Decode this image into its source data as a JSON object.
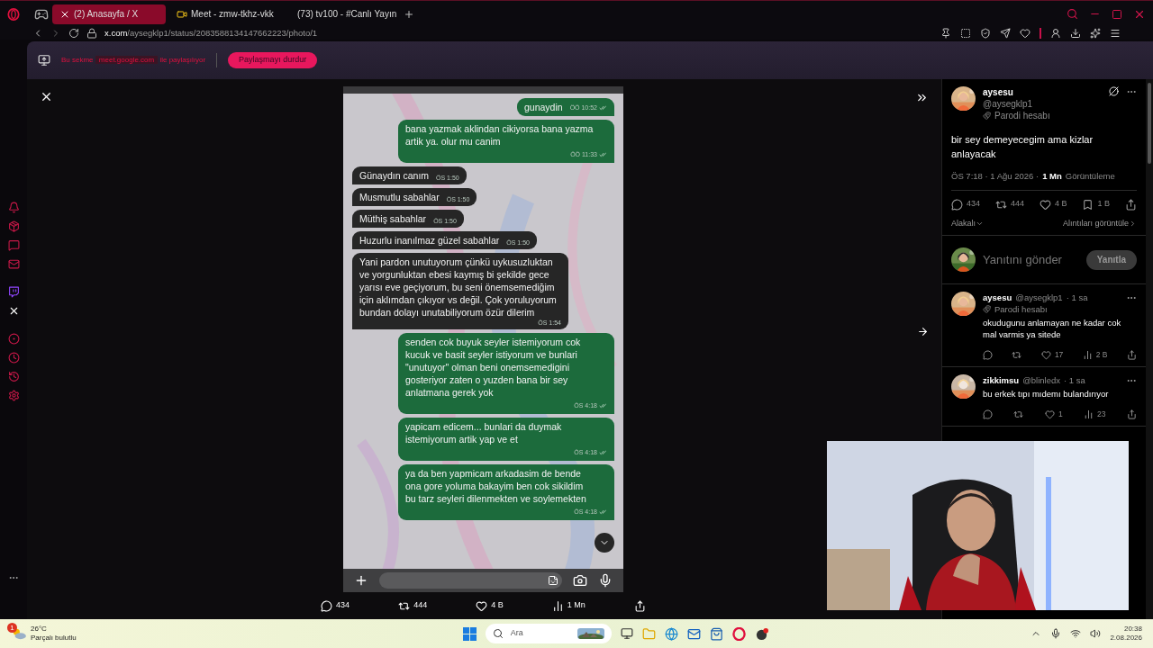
{
  "browser": {
    "tabs": [
      {
        "kind": "x",
        "title": "(2) Anasayfa / X",
        "selected": true
      },
      {
        "kind": "meet",
        "title": "Meet - zmw-tkhz-vkk",
        "selected": false
      },
      {
        "kind": "youtube",
        "title": "(73) tv100 - #Canlı Yayın",
        "selected": false
      }
    ],
    "url_host": "x.com",
    "url_path": "/aysegklp1/status/2083588134147662223/photo/1"
  },
  "share_banner": {
    "text_before": "Bu sekme",
    "site": "meet.google.com",
    "text_after": "ile paylaşılıyor",
    "button": "Paylaşmayı durdur"
  },
  "chat": {
    "messages": [
      {
        "kind": "sent",
        "text": "gunaydin",
        "time": "ÖÖ 10:52",
        "read": true
      },
      {
        "kind": "sent",
        "text": "bana yazmak aklindan cikiyorsa bana yazma artik ya. olur mu canim",
        "time": "ÖÖ 11:33",
        "read": true
      },
      {
        "kind": "received",
        "text": "Günaydın canım",
        "time": "ÖS 1:50",
        "read": false
      },
      {
        "kind": "received",
        "text": "Musmutlu sabahlar",
        "time": "ÖS 1:50",
        "read": false
      },
      {
        "kind": "received",
        "text": "Müthiş sabahlar",
        "time": "ÖS 1:50",
        "read": false
      },
      {
        "kind": "received",
        "text": "Huzurlu inanılmaz güzel sabahlar",
        "time": "ÖS 1:50",
        "read": false
      },
      {
        "kind": "received",
        "text": "Yani pardon unutuyorum çünkü uykusuzluktan ve yorgunluktan ebesi kaymış bi şekilde gece yarısı eve geçiyorum, bu seni önemsemediğim için aklımdan çıkıyor vs değil. Çok yoruluyorum bundan dolayı unutabiliyorum özür dilerim",
        "time": "ÖS 1:54",
        "read": false
      },
      {
        "kind": "sent",
        "text": "senden cok buyuk seyler istemiyorum cok kucuk ve basit seyler istiyorum ve bunlari \"unutuyor\" olman beni onemsemedigini gosteriyor zaten o yuzden bana bir sey anlatmana gerek yok",
        "time": "ÖS 4:18",
        "read": true
      },
      {
        "kind": "sent",
        "text": "yapicam edicem... bunlari da duymak istemiyorum artik yap ve et",
        "time": "ÖS 4:18",
        "read": true
      },
      {
        "kind": "sent",
        "text": "ya da ben yapmicam arkadasim de bende ona gore yoluma bakayim ben cok sikildim bu tarz seyleri dilenmekten ve soylemekten",
        "time": "ÖS 4:18",
        "read": true
      }
    ]
  },
  "photo_actions": [
    {
      "kind": "reply",
      "count": "434"
    },
    {
      "kind": "repost",
      "count": "444"
    },
    {
      "kind": "like",
      "count": "4 B"
    },
    {
      "kind": "views",
      "count": "1 Mn"
    },
    {
      "kind": "share"
    }
  ],
  "tweet": {
    "name": "aysesu",
    "handle": "@aysegklp1",
    "badge": "Parodi hesabı",
    "text": "bir sey demeyecegim ama kizlar anlayacak",
    "meta": "ÖS 7:18 · 1 Ağu 2026 ·",
    "views_count": "1 Mn",
    "views_label": "Görüntüleme",
    "stats": [
      {
        "kind": "reply",
        "count": "434"
      },
      {
        "kind": "repost",
        "count": "444"
      },
      {
        "kind": "like",
        "count": "4 B"
      },
      {
        "kind": "bookmark",
        "count": "1 B"
      },
      {
        "kind": "share"
      }
    ],
    "sort": "Alakalı",
    "quotes": "Alıntıları görüntüle"
  },
  "reply_box": {
    "placeholder": "Yanıtını gönder",
    "button": "Yanıtla"
  },
  "replies": [
    {
      "name": "aysesu",
      "handle": "@aysegklp1",
      "time": "· 1 sa",
      "badge": "Parodi hesabı",
      "text": "okudugunu anlamayan ne kadar cok mal varmis ya sitede",
      "stats": [
        {
          "kind": "reply"
        },
        {
          "kind": "repost"
        },
        {
          "kind": "like",
          "count": "17"
        },
        {
          "kind": "views",
          "count": "2 B"
        },
        {
          "kind": "share"
        }
      ]
    },
    {
      "name": "zikkimsu",
      "handle": "@blinledx",
      "time": "· 1 sa",
      "text": "bu erkek tıpı mıdemı bulandırıyor",
      "stats": [
        {
          "kind": "reply"
        },
        {
          "kind": "repost"
        },
        {
          "kind": "like",
          "count": "1"
        },
        {
          "kind": "views",
          "count": "23"
        },
        {
          "kind": "share"
        }
      ]
    }
  ],
  "taskbar": {
    "weather_badge": "1",
    "temperature": "26°C",
    "weather": "Parçalı bulutlu",
    "search_placeholder": "Ara",
    "time": "20:38",
    "date": "2.08.2026"
  }
}
